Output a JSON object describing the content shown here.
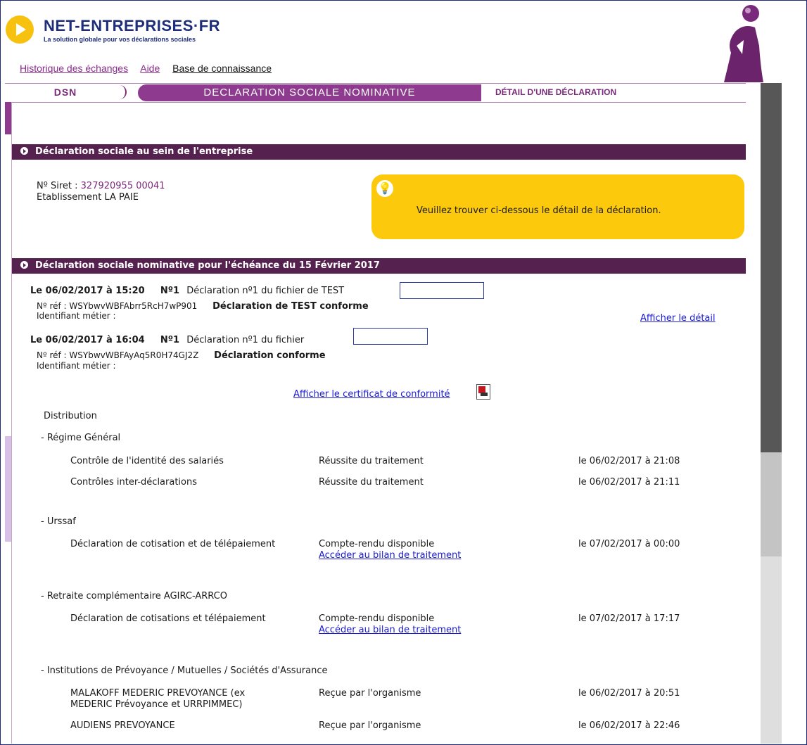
{
  "header": {
    "brand": "NET-ENTREPRISES·FR",
    "tagline": "La solution globale pour vos déclarations sociales",
    "links": [
      "Historique des échanges",
      "Aide",
      "Base de connaissance"
    ]
  },
  "title_band": {
    "dsn": "DSN",
    "declaration": "DECLARATION SOCIALE NOMINATIVE",
    "detail": "DÉTAIL D'UNE DÉCLARATION"
  },
  "section1": {
    "title": "Déclaration sociale au sein de l'entreprise",
    "siret_label": "Nº Siret : ",
    "siret_value": "327920955 00041",
    "etablissement": "Etablissement LA PAIE",
    "info_text": "Veuillez trouver ci-dessous le détail de la déclaration."
  },
  "section2": {
    "title": "Déclaration sociale nominative pour l'échéance du 15 Février 2017",
    "declarations": [
      {
        "date": "Le 06/02/2017 à 15:20",
        "num": "Nº1",
        "desc": "Déclaration nº1 du fichier de TEST",
        "ref_label": "Nº réf : WSYbwvWBFAbrr5RcH7wP901",
        "status": "Déclaration de TEST conforme",
        "metier": "Identifiant métier :"
      },
      {
        "date": "Le 06/02/2017 à 16:04",
        "num": "Nº1",
        "desc": "Déclaration nº1 du fichier",
        "ref_label": "Nº réf : WSYbwvWBFAyAq5R0H74GJ2Z",
        "status": "Déclaration conforme",
        "metier": "Identifiant métier :"
      }
    ],
    "afficher_detail": "Afficher le détail",
    "afficher_certificat": "Afficher le certificat de conformité",
    "distribution": "Distribution",
    "groups": [
      {
        "name": "- Régime Général",
        "rows": [
          {
            "label": "Contrôle de l'identité des salariés",
            "status": "Réussite du traitement",
            "link": "",
            "date": "le 06/02/2017 à 21:08"
          },
          {
            "label": "Contrôles inter-déclarations",
            "status": "Réussite du traitement",
            "link": "",
            "date": "le 06/02/2017 à 21:11"
          }
        ]
      },
      {
        "name": "- Urssaf",
        "rows": [
          {
            "label": "Déclaration de cotisation et de télépaiement",
            "status": "Compte-rendu disponible",
            "link": "Accéder au bilan de traitement",
            "date": "le 07/02/2017 à 00:00"
          }
        ]
      },
      {
        "name": "- Retraite complémentaire AGIRC-ARRCO",
        "rows": [
          {
            "label": "Déclaration de cotisations et télépaiement",
            "status": "Compte-rendu disponible",
            "link": "Accéder au bilan de traitement",
            "date": "le 07/02/2017 à 17:17"
          }
        ]
      },
      {
        "name": "- Institutions de Prévoyance / Mutuelles / Sociétés d'Assurance",
        "rows": [
          {
            "label": "MALAKOFF MEDERIC PREVOYANCE (ex",
            "label2": "MEDERIC Prévoyance et URRPIMMEC)",
            "status": "Reçue par l'organisme",
            "link": "",
            "date": "le 06/02/2017 à 20:51"
          },
          {
            "label": "AUDIENS PREVOYANCE",
            "status": "Reçue par l'organisme",
            "link": "",
            "date": "le 06/02/2017 à 22:46"
          }
        ]
      }
    ]
  },
  "colors": {
    "brand_purple": "#8e3a8e",
    "section_dark": "#55214f",
    "info_yellow": "#fcc90c",
    "link_blue": "#1a1ad6"
  }
}
